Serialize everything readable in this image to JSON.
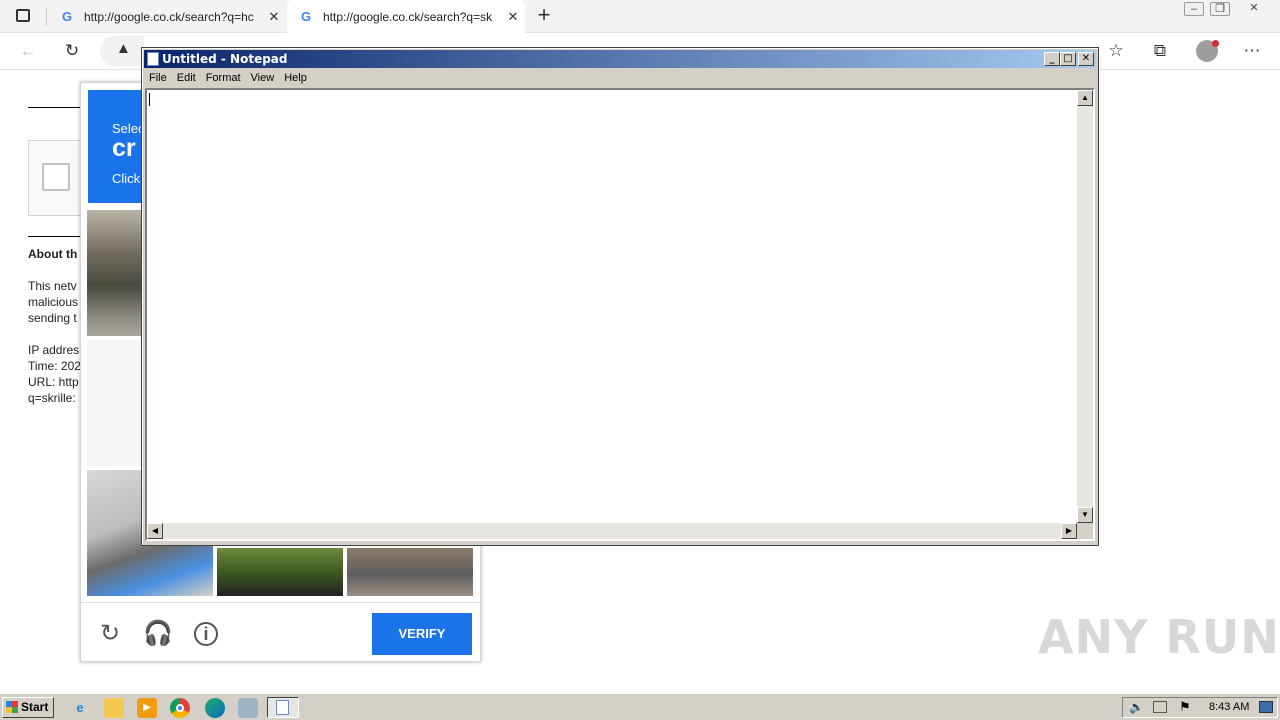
{
  "browser": {
    "tabs": [
      {
        "title": "http://google.co.ck/search?q=hc",
        "active": false
      },
      {
        "title": "http://google.co.ck/search?q=sk",
        "active": true
      }
    ],
    "new_tab_symbol": "+",
    "tab_close_symbol": "✕"
  },
  "page": {
    "about_heading": "About th",
    "para_lines": [
      "This netv",
      "malicious",
      "sending t"
    ],
    "info_lines": [
      "IP addres",
      "Time: 202",
      "URL: http",
      "q=skrille:"
    ]
  },
  "captcha": {
    "header_line1": "Selec",
    "header_line2": "cr",
    "header_line3": "Click",
    "verify_label": "VERIFY",
    "icons": [
      "reload-icon",
      "headphones-icon",
      "info-icon"
    ]
  },
  "notepad": {
    "title": "Untitled - Notepad",
    "menu": [
      "File",
      "Edit",
      "Format",
      "View",
      "Help"
    ],
    "content": ""
  },
  "taskbar": {
    "start_label": "Start",
    "clock": "8:43 AM"
  },
  "watermark": "ANY RUN"
}
